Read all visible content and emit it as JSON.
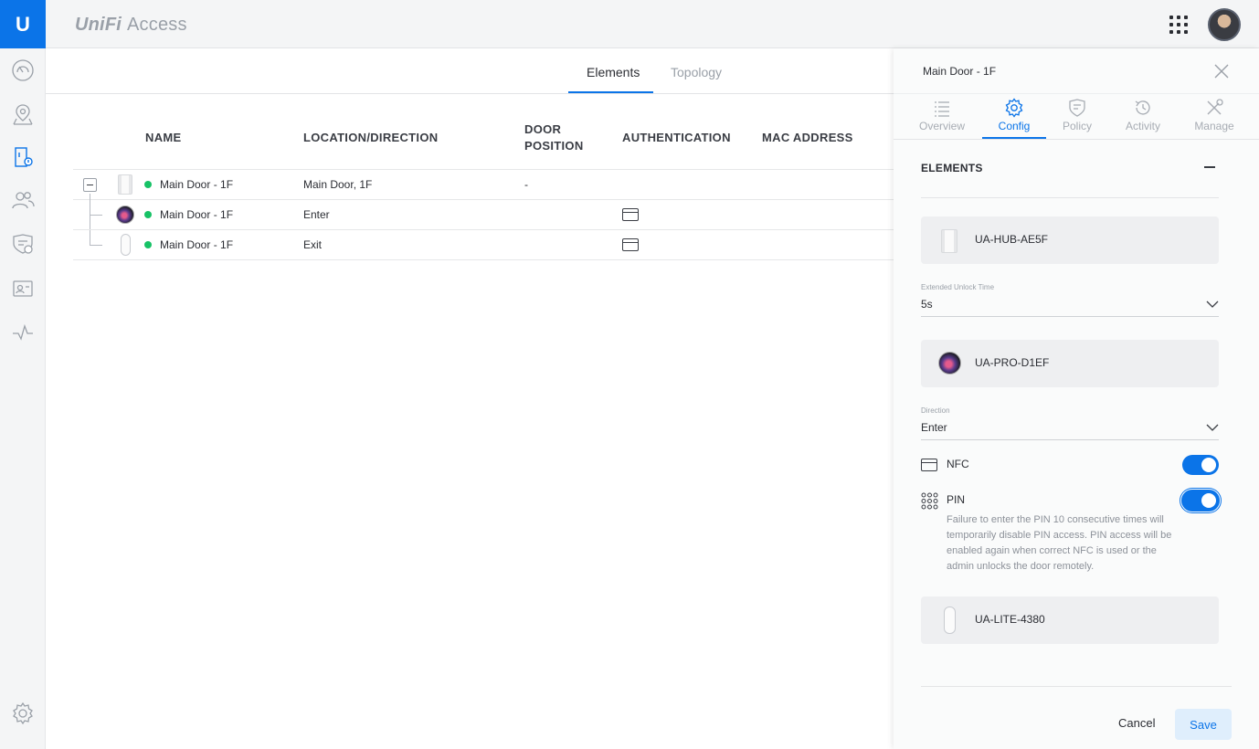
{
  "app": {
    "brand_uni": "UniFi",
    "brand_product": "Access",
    "logo_letter": "U"
  },
  "colors": {
    "accent": "#0b74e8",
    "online": "#17c266"
  },
  "sidebar": {
    "items": [
      {
        "icon": "dashboard-icon"
      },
      {
        "icon": "map-icon"
      },
      {
        "icon": "doors-icon",
        "active": true
      },
      {
        "icon": "users-icon"
      },
      {
        "icon": "policies-icon"
      },
      {
        "icon": "visitors-icon"
      },
      {
        "icon": "activity-icon"
      }
    ],
    "settings_icon": "gear-icon"
  },
  "main": {
    "tabs": [
      {
        "label": "Elements",
        "active": true
      },
      {
        "label": "Topology",
        "active": false
      }
    ],
    "columns": {
      "name": "NAME",
      "location": "LOCATION/DIRECTION",
      "door_position_1": "DOOR",
      "door_position_2": "POSITION",
      "authentication": "AUTHENTICATION",
      "mac": "MAC ADDRESS"
    },
    "rows": [
      {
        "device": "hub",
        "name": "Main Door - 1F",
        "location": "Main Door, 1F",
        "door_position": "-",
        "auth_icon": false,
        "status": "online"
      },
      {
        "device": "pro",
        "name": "Main Door - 1F",
        "location": "Enter",
        "door_position": "",
        "auth_icon": true,
        "status": "online"
      },
      {
        "device": "lite",
        "name": "Main Door - 1F",
        "location": "Exit",
        "door_position": "",
        "auth_icon": true,
        "status": "online"
      }
    ]
  },
  "panel": {
    "title": "Main Door - 1F",
    "tabs": [
      {
        "label": "Overview",
        "icon": "list-icon"
      },
      {
        "label": "Config",
        "icon": "gear-icon",
        "active": true
      },
      {
        "label": "Policy",
        "icon": "policy-icon"
      },
      {
        "label": "Activity",
        "icon": "history-icon"
      },
      {
        "label": "Manage",
        "icon": "tools-icon"
      }
    ],
    "section_title": "ELEMENTS",
    "hub": {
      "name": "UA-HUB-AE5F",
      "field_label": "Extended Unlock Time",
      "field_value": "5s"
    },
    "pro": {
      "name": "UA-PRO-D1EF",
      "field_label": "Direction",
      "field_value": "Enter"
    },
    "nfc": {
      "label": "NFC",
      "enabled": true
    },
    "pin": {
      "label": "PIN",
      "enabled": true,
      "help": "Failure to enter the PIN 10 consecutive times will temporarily disable PIN access. PIN access will be enabled again when correct NFC is used or the admin unlocks the door remotely."
    },
    "lite": {
      "name": "UA-LITE-4380"
    },
    "cancel_label": "Cancel",
    "save_label": "Save"
  }
}
